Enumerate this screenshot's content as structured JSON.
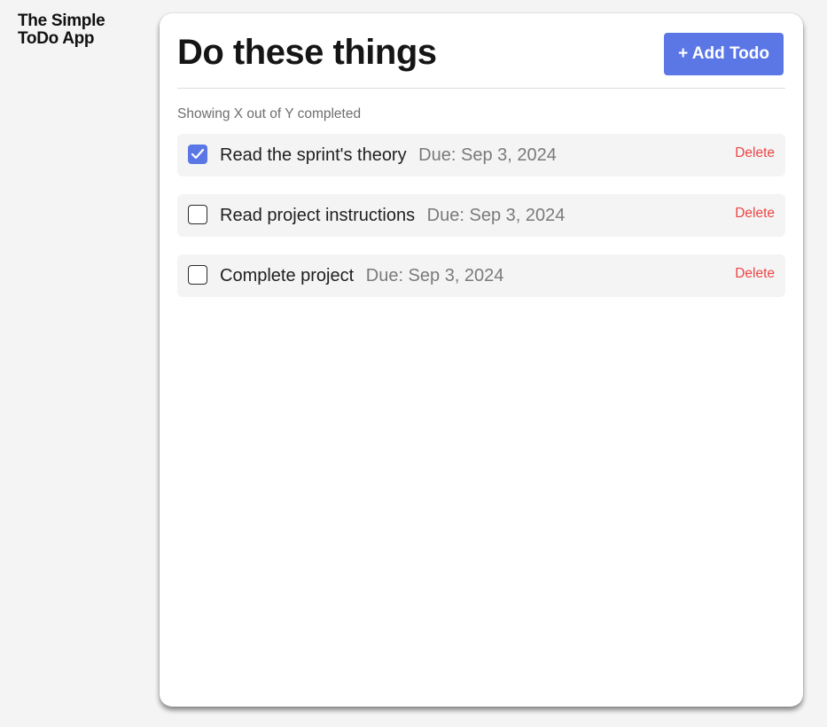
{
  "app": {
    "title": "The Simple ToDo App"
  },
  "header": {
    "title": "Do these things",
    "add_button_label": "+ Add Todo"
  },
  "status": {
    "text": "Showing X out of Y completed"
  },
  "todos": [
    {
      "title": "Read the sprint's theory",
      "due": "Due: Sep 3, 2024",
      "completed": true,
      "delete_label": "Delete"
    },
    {
      "title": "Read project instructions",
      "due": "Due: Sep 3, 2024",
      "completed": false,
      "delete_label": "Delete"
    },
    {
      "title": "Complete project",
      "due": "Due: Sep 3, 2024",
      "completed": false,
      "delete_label": "Delete"
    }
  ],
  "colors": {
    "accent": "#5b77e6",
    "delete": "#ef4444",
    "background": "#f4f4f4",
    "card": "#ffffff"
  },
  "icons": {
    "checkbox_checked": "check-icon"
  }
}
